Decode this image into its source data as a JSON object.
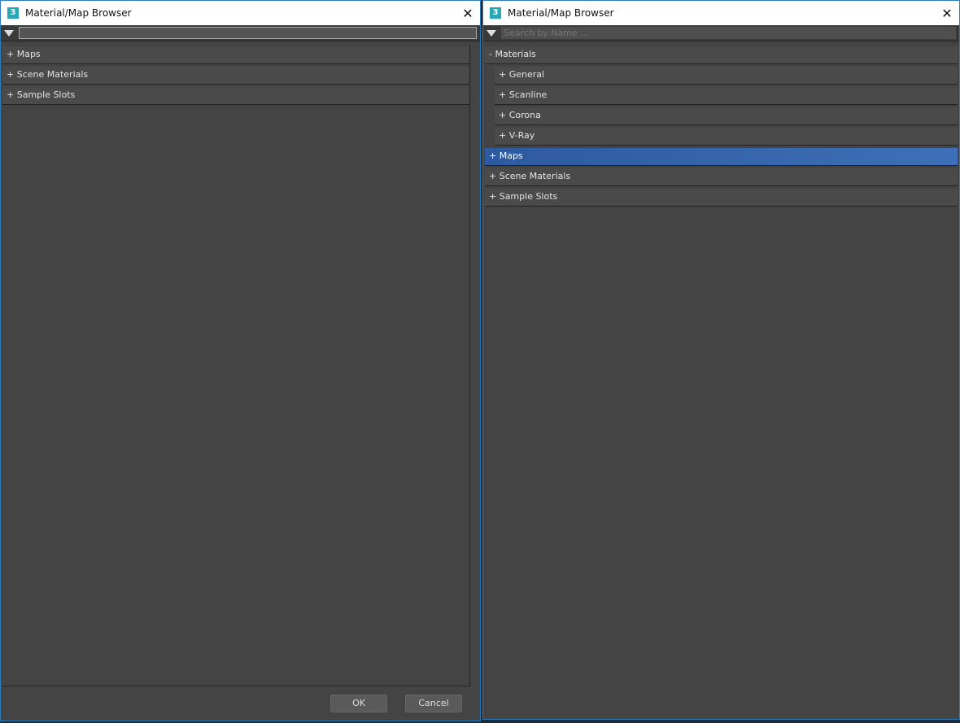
{
  "left": {
    "title": "Material/Map Browser",
    "search_value": "",
    "items": [
      "+ Maps",
      "+ Scene Materials",
      "+ Sample Slots"
    ],
    "ok": "OK",
    "cancel": "Cancel"
  },
  "right": {
    "title": "Material/Map Browser",
    "search_placeholder": "Search by Name ...",
    "materials": "- Materials",
    "sub": [
      "+ General",
      "+ Scanline",
      "+ Corona",
      "+ V-Ray"
    ],
    "items": [
      "+ Maps",
      "+ Scene Materials",
      "+ Sample Slots"
    ]
  },
  "logo": "3"
}
